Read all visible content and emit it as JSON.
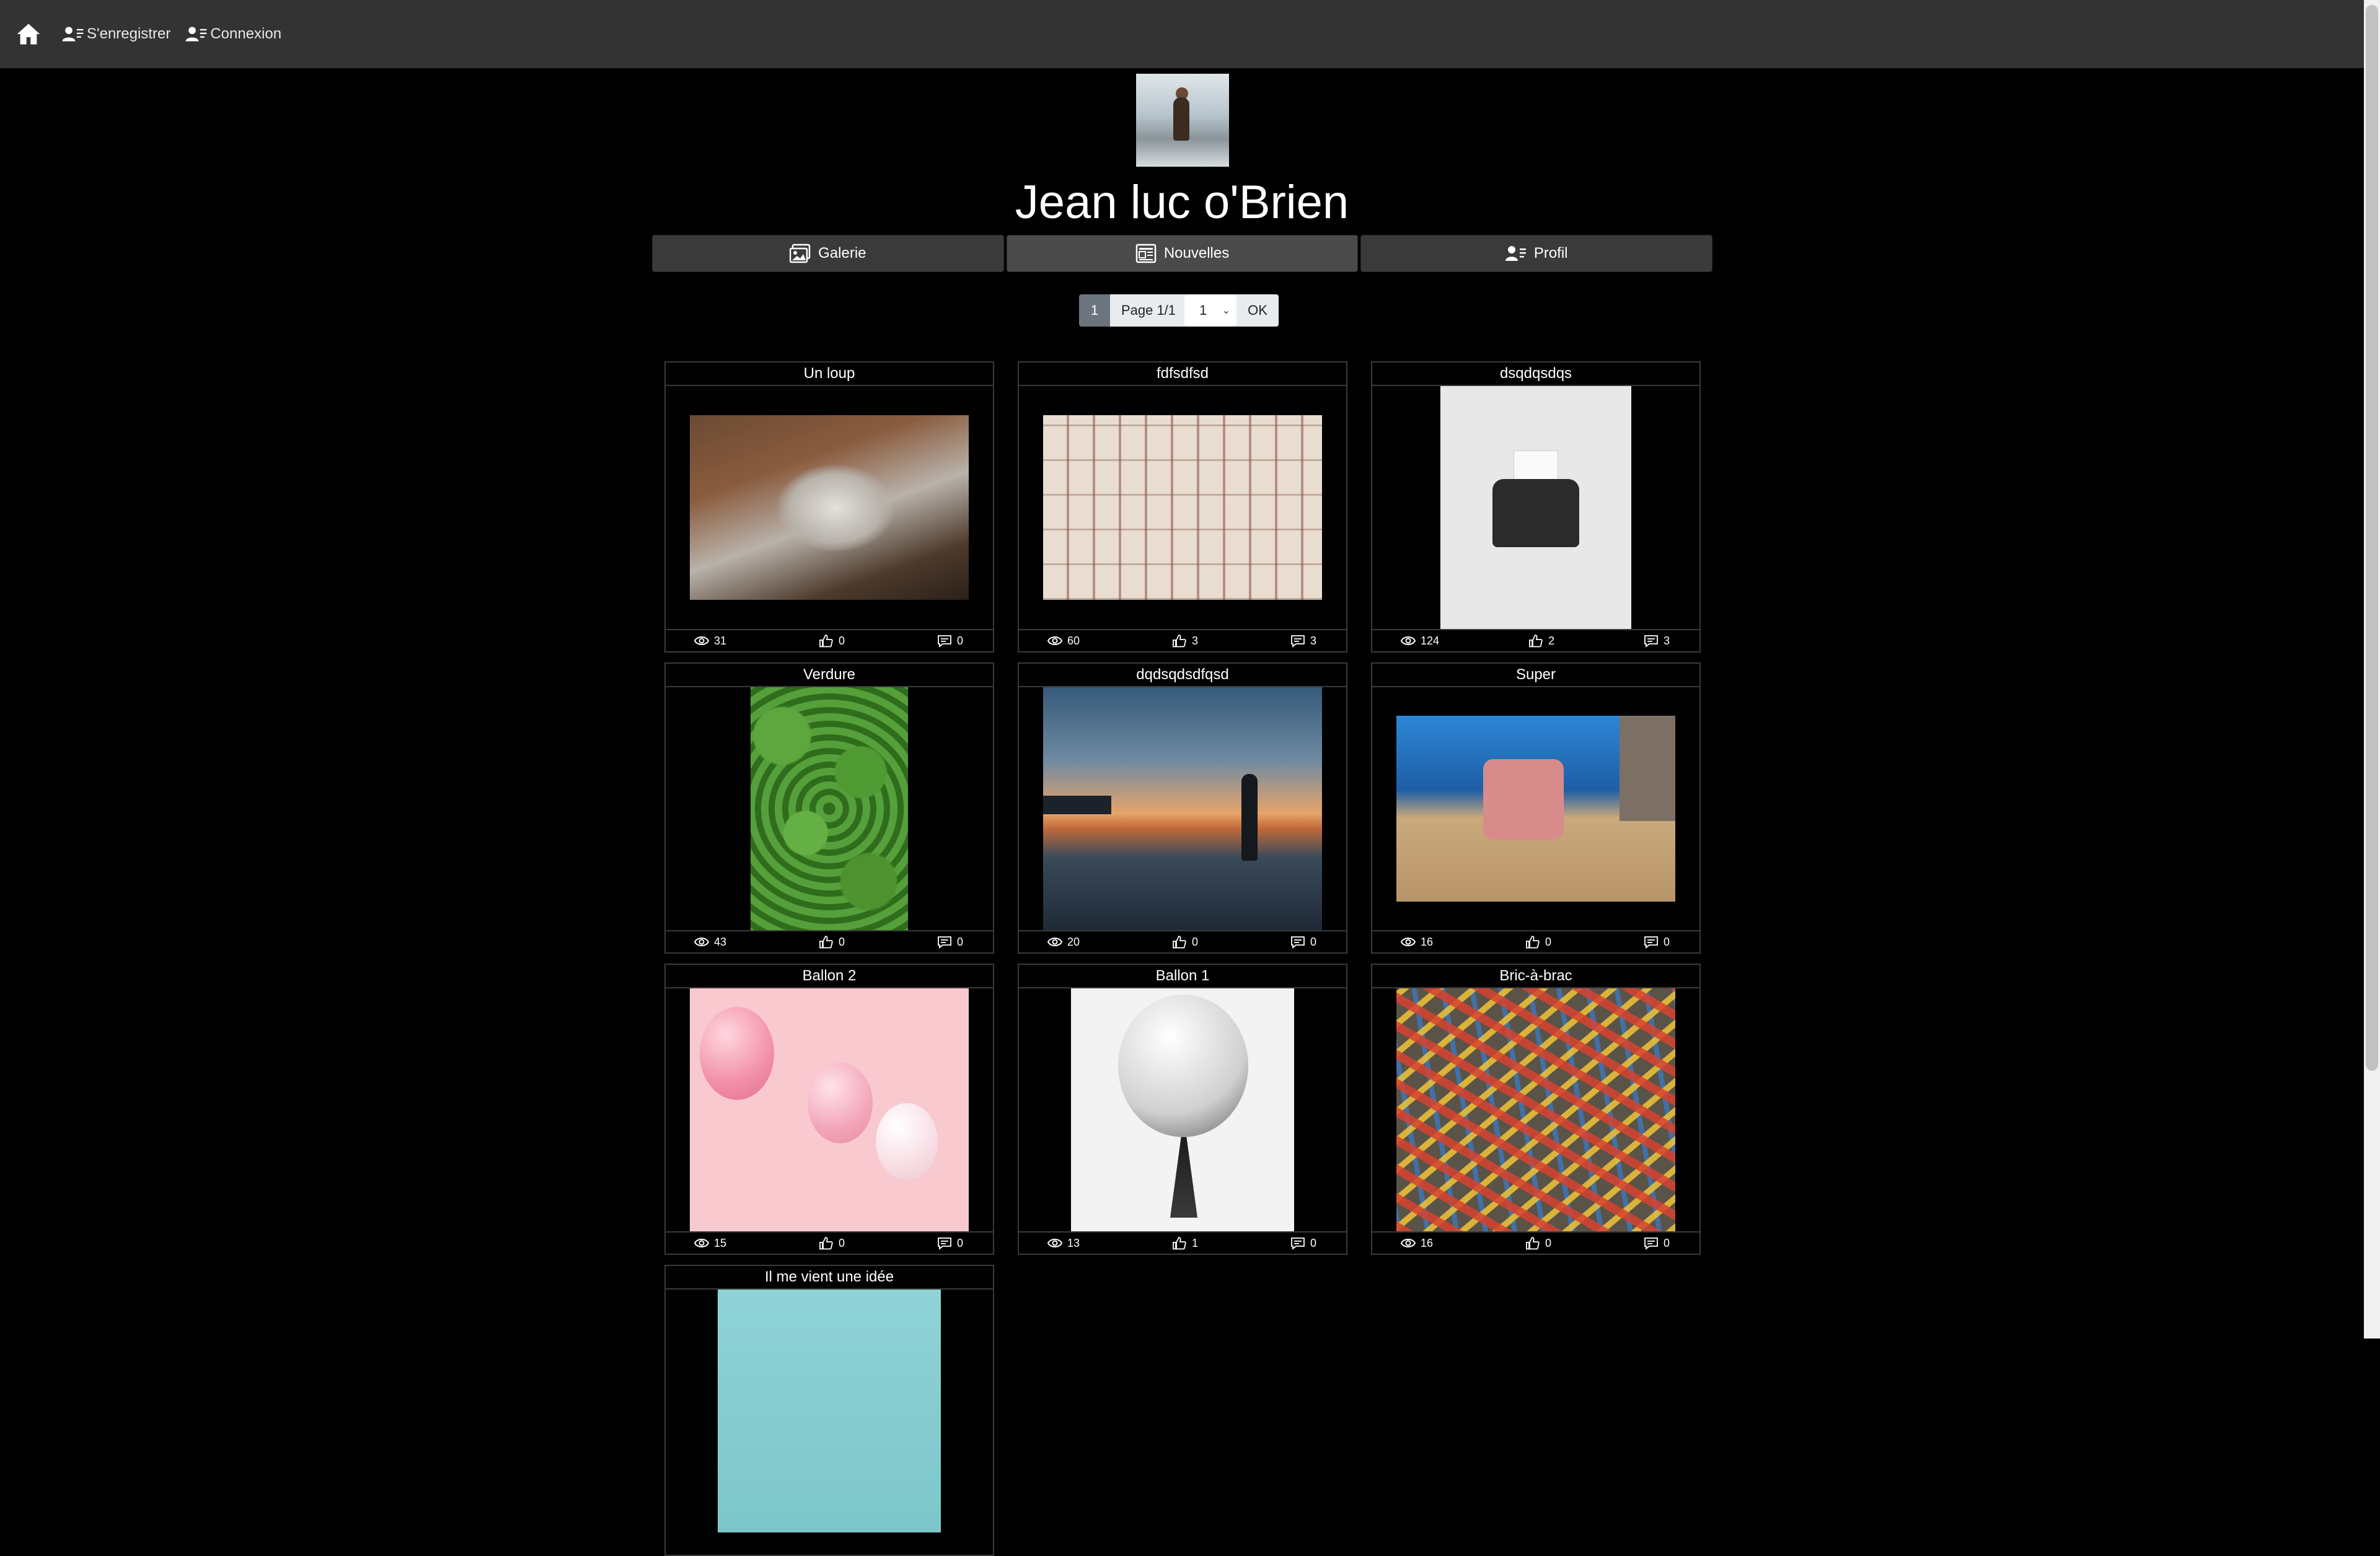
{
  "navbar": {
    "register_label": "S'enregistrer",
    "login_label": "Connexion"
  },
  "profile": {
    "name": "Jean luc o'Brien"
  },
  "tabs": [
    {
      "label": "Galerie",
      "icon": "gallery-icon"
    },
    {
      "label": "Nouvelles",
      "icon": "newspaper-icon"
    },
    {
      "label": "Profil",
      "icon": "user-list-icon"
    }
  ],
  "pagination": {
    "current_page": "1",
    "page_label": "Page 1/1",
    "select_value": "1",
    "ok_label": "OK"
  },
  "gallery": [
    {
      "title": "Un loup",
      "views": "31",
      "likes": "0",
      "comments": "0"
    },
    {
      "title": "fdfsdfsd",
      "views": "60",
      "likes": "3",
      "comments": "3"
    },
    {
      "title": "dsqdqsdqs",
      "views": "124",
      "likes": "2",
      "comments": "3"
    },
    {
      "title": "Verdure",
      "views": "43",
      "likes": "0",
      "comments": "0"
    },
    {
      "title": "dqdsqdsdfqsd",
      "views": "20",
      "likes": "0",
      "comments": "0"
    },
    {
      "title": "Super",
      "views": "16",
      "likes": "0",
      "comments": "0"
    },
    {
      "title": "Ballon 2",
      "views": "15",
      "likes": "0",
      "comments": "0"
    },
    {
      "title": "Ballon 1",
      "views": "13",
      "likes": "1",
      "comments": "0"
    },
    {
      "title": "Bric-à-brac",
      "views": "16",
      "likes": "0",
      "comments": "0"
    },
    {
      "title": "Il me vient une idée"
    }
  ]
}
